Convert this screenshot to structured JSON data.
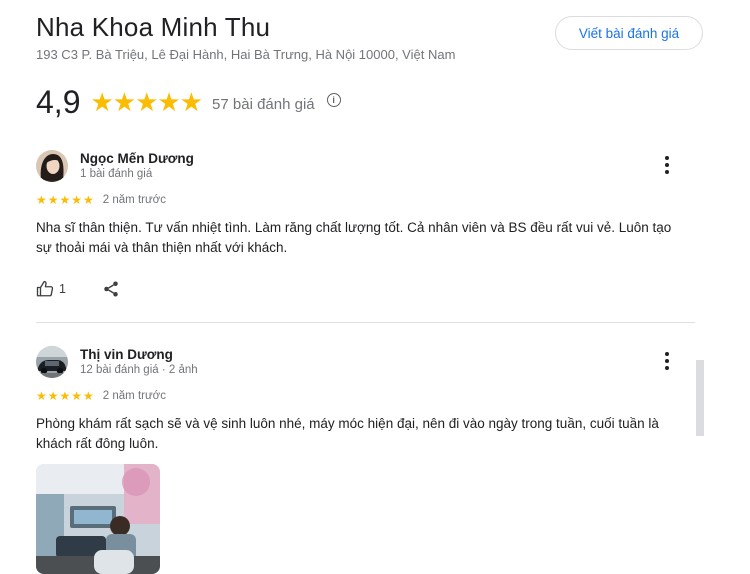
{
  "header": {
    "title": "Nha Khoa Minh Thu",
    "address": "193 C3 P. Bà Triệu, Lê Đại Hành, Hai Bà Trưng, Hà Nội 10000, Việt Nam",
    "write_review_label": "Viết bài đánh giá"
  },
  "summary": {
    "rating": "4,9",
    "stars": "★★★★★",
    "review_count": "57 bài đánh giá",
    "info_icon_glyph": "i"
  },
  "reviews": [
    {
      "name": "Ngọc Mến Dương",
      "meta": "1 bài đánh giá",
      "stars": "★★★★★",
      "time": "2 năm trước",
      "text": "Nha sĩ thân thiện. Tư vấn nhiệt tình. Làm răng chất lượng tốt. Cả nhân viên và BS đều rất vui vẻ. Luôn tạo sự thoải mái và thân thiện nhất với khách.",
      "likes": "1"
    },
    {
      "name": "Thị vin Dương",
      "meta": "12 bài đánh giá · 2 ảnh",
      "stars": "★★★★★",
      "time": "2 năm trước",
      "text": "Phòng khám rất sạch sẽ và vệ sinh luôn nhé, máy móc hiện đại, nên đi vào ngày trong tuần, cuối tuần là khách rất đông luôn."
    }
  ],
  "colors": {
    "star": "#fbbc04",
    "link": "#1a73e8",
    "text": "#202124",
    "secondary": "#70757a"
  },
  "icons": [
    "info-icon",
    "more-vert-icon",
    "thumb-up-icon",
    "share-icon"
  ]
}
